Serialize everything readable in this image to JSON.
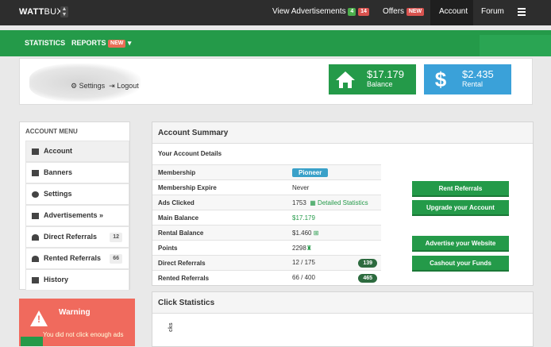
{
  "topbar": {
    "logo_main": "WATT",
    "logo_sub": "BUX",
    "nav_view_ads": "View Advertisements",
    "ads_count_green": "4",
    "ads_count_red": "14",
    "nav_offers": "Offers",
    "offers_badge": "NEW",
    "nav_account": "Account",
    "nav_forum": "Forum"
  },
  "subnav": {
    "statistics": "STATISTICS",
    "reports": "REPORTS",
    "reports_badge": "NEW"
  },
  "user": {
    "settings": "Settings",
    "logout": "Logout"
  },
  "balance": {
    "value": "$17.179",
    "label": "Balance"
  },
  "rental": {
    "value": "$2.435",
    "label": "Rental"
  },
  "menu": {
    "title": "ACCOUNT MENU",
    "items": [
      {
        "label": "Account"
      },
      {
        "label": "Banners"
      },
      {
        "label": "Settings"
      },
      {
        "label": "Advertisements »"
      },
      {
        "label": "Direct Referrals",
        "count": "12"
      },
      {
        "label": "Rented Referrals",
        "count": "66"
      },
      {
        "label": "History"
      }
    ]
  },
  "warning": {
    "title": "Warning",
    "message": "You did not click enough ads"
  },
  "summary": {
    "title": "Account Summary",
    "subtitle": "Your Account Details",
    "rows": [
      {
        "key": "Membership",
        "value": "Pioneer"
      },
      {
        "key": "Membership Expire",
        "value": "Never"
      },
      {
        "key": "Ads Clicked",
        "value": "1753",
        "extra": "Detailed Statistics"
      },
      {
        "key": "Main Balance",
        "value": "$17.179"
      },
      {
        "key": "Rental Balance",
        "value": "$1.460"
      },
      {
        "key": "Points",
        "value": "2298"
      },
      {
        "key": "Direct Referrals",
        "value": "12 / 175",
        "count": "139"
      },
      {
        "key": "Rented Referrals",
        "value": "66 / 400",
        "count": "465"
      }
    ]
  },
  "buttons": {
    "rent": "Rent Referrals",
    "upgrade": "Upgrade your Account",
    "advertise": "Advertise your Website",
    "cashout": "Cashout your Funds"
  },
  "clickstats": {
    "title": "Click Statistics",
    "ylabel": "cks"
  },
  "colors": {
    "green": "#249a49",
    "topbar": "#2d2d2d",
    "warning": "#f06a5d",
    "rental": "#3aa1d9"
  }
}
